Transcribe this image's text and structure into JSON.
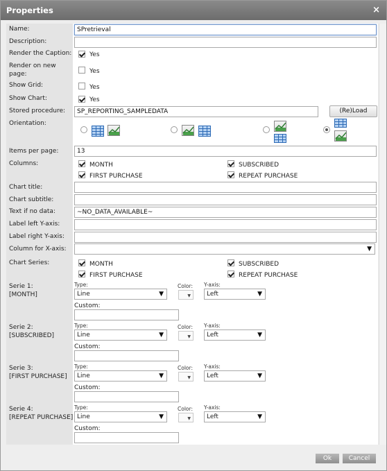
{
  "window": {
    "title": "Properties",
    "close_label": "×"
  },
  "fields": {
    "name": {
      "label": "Name:",
      "value": "SPretrieval"
    },
    "description": {
      "label": "Description:",
      "value": ""
    },
    "render_caption": {
      "label": "Render the Caption:",
      "checked": true,
      "option": "Yes"
    },
    "render_new_page": {
      "label_line1": "Render on new",
      "label_line2": "page:",
      "checked": false,
      "option": "Yes"
    },
    "show_grid": {
      "label": "Show Grid:",
      "checked": false,
      "option": "Yes"
    },
    "show_chart": {
      "label": "Show Chart:",
      "checked": true,
      "option": "Yes"
    },
    "stored_procedure": {
      "label": "Stored procedure:",
      "value": "SP_REPORTING_SAMPLEDATA",
      "reload_label": "(Re)Load"
    },
    "orientation": {
      "label": "Orientation:",
      "selected_index": 3
    },
    "items_per_page": {
      "label": "Items per page:",
      "value": "13"
    },
    "columns": {
      "label": "Columns:",
      "options": [
        {
          "label": "MONTH",
          "checked": true
        },
        {
          "label": "SUBSCRIBED",
          "checked": true
        },
        {
          "label": "FIRST PURCHASE",
          "checked": true
        },
        {
          "label": "REPEAT PURCHASE",
          "checked": true
        }
      ]
    },
    "chart_title": {
      "label": "Chart title:",
      "value": ""
    },
    "chart_subtitle": {
      "label": "Chart subtitle:",
      "value": ""
    },
    "text_no_data": {
      "label": "Text if no data:",
      "value": "~NO_DATA_AVAILABLE~"
    },
    "label_left_y": {
      "label": "Label left Y-axis:",
      "value": ""
    },
    "label_right_y": {
      "label": "Label right Y-axis:",
      "value": ""
    },
    "column_x_axis": {
      "label": "Column for X-axis:",
      "value": ""
    },
    "chart_series": {
      "label": "Chart Series:",
      "options": [
        {
          "label": "MONTH",
          "checked": true
        },
        {
          "label": "SUBSCRIBED",
          "checked": true
        },
        {
          "label": "FIRST PURCHASE",
          "checked": true
        },
        {
          "label": "REPEAT PURCHASE",
          "checked": true
        }
      ]
    }
  },
  "series_labels": {
    "type": "Type:",
    "color": "Color:",
    "yaxis": "Y-axis:",
    "custom": "Custom:"
  },
  "series": [
    {
      "title": "Serie 1:",
      "name": "[MONTH]",
      "type": "Line",
      "yaxis": "Left",
      "custom": ""
    },
    {
      "title": "Serie 2:",
      "name": "[SUBSCRIBED]",
      "type": "Line",
      "yaxis": "Left",
      "custom": ""
    },
    {
      "title": "Serie 3:",
      "name": "[FIRST PURCHASE]",
      "type": "Line",
      "yaxis": "Left",
      "custom": ""
    },
    {
      "title": "Serie 4:",
      "name": "[REPEAT PURCHASE]",
      "type": "Line",
      "yaxis": "Left",
      "custom": ""
    }
  ],
  "buttons": {
    "ok": "Ok",
    "cancel": "Cancel"
  },
  "icons": {
    "dropdown": "▼",
    "grid": "grid-icon",
    "chart": "chart-icon"
  }
}
